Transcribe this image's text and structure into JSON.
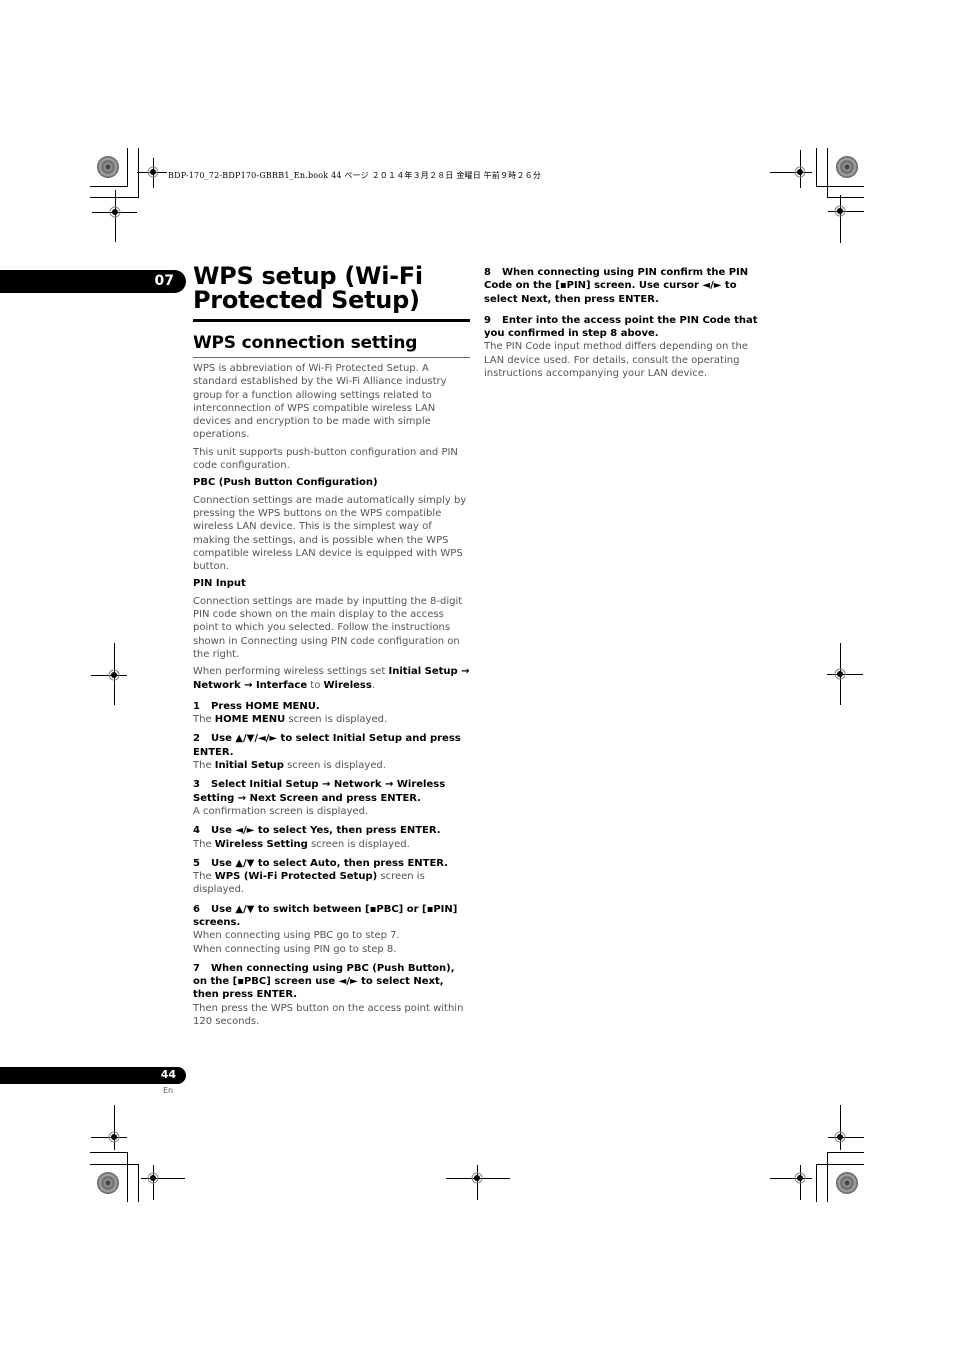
{
  "print_header": "BDP-170_72-BDP170-GBRB1_En.book  44 ページ  ２０１４年３月２８日  金曜日  午前９時２６分",
  "chapter": {
    "number": "07"
  },
  "title": "WPS setup (Wi-Fi Protected Setup)",
  "section": {
    "heading": "WPS connection setting",
    "intro": [
      "WPS is abbreviation of Wi-Fi Protected Setup. A standard established by the Wi-Fi Alliance industry group for a function allowing settings related to interconnection of WPS compatible wireless LAN devices and encryption to be made with simple operations.",
      "This unit supports push-button configuration and PIN code configuration."
    ],
    "pbc": {
      "heading": "PBC (Push Button Configuration)",
      "text": "Connection settings are made automatically simply by pressing the WPS buttons on the WPS compatible wireless LAN device. This is the simplest way of making the settings, and is possible when the WPS compatible wireless LAN device is equipped with WPS button."
    },
    "pin": {
      "heading": "PIN Input",
      "text": "Connection settings are made by inputting the 8-digit PIN code shown on the main display to the access point to which you selected. Follow the instructions shown in Connecting using PIN code configuration on the right."
    },
    "wireless_note": {
      "prefix": "When performing wireless settings set ",
      "b1": "Initial Setup",
      "arrow1": " → ",
      "b2": "Network",
      "arrow2": " → ",
      "b3": "Interface",
      "mid": " to ",
      "b4": "Wireless",
      "suffix": "."
    },
    "steps": [
      {
        "n": "1",
        "title": "Press HOME MENU.",
        "desc_pre": "The ",
        "desc_bold": "HOME MENU",
        "desc_post": " screen is displayed."
      },
      {
        "n": "2",
        "title": "Use ▲/▼/◄/► to select Initial Setup and press ENTER.",
        "desc_pre": "The ",
        "desc_bold": "Initial Setup",
        "desc_post": " screen is displayed."
      },
      {
        "n": "3",
        "title": "Select Initial Setup → Network → Wireless Setting → Next Screen and press ENTER.",
        "desc_pre": "A confirmation screen is displayed.",
        "desc_bold": "",
        "desc_post": ""
      },
      {
        "n": "4",
        "title": "Use ◄/► to select Yes, then press ENTER.",
        "desc_pre": "The ",
        "desc_bold": "Wireless Setting",
        "desc_post": " screen is displayed."
      },
      {
        "n": "5",
        "title": "Use ▲/▼ to select Auto, then press ENTER.",
        "desc_pre": "The ",
        "desc_bold": "WPS (Wi-Fi Protected Setup)",
        "desc_post": " screen is displayed."
      },
      {
        "n": "6",
        "title": "Use ▲/▼ to switch between [▪PBC] or [▪PIN] screens.",
        "desc_lines": [
          "When connecting using PBC go to step 7.",
          "When connecting using PIN go to step 8."
        ]
      },
      {
        "n": "7",
        "title": "When connecting using PBC (Push Button), on the [▪PBC] screen use ◄/► to select Next, then press ENTER.",
        "desc_pre": "Then press the WPS button on the access point within 120 seconds.",
        "desc_bold": "",
        "desc_post": ""
      },
      {
        "n": "8",
        "title": "When connecting using PIN confirm the PIN Code on the [▪PIN] screen. Use cursor ◄/► to select Next, then press ENTER."
      },
      {
        "n": "9",
        "title": "Enter into the access point the PIN Code that you confirmed in step 8 above.",
        "desc_pre": "The PIN Code input method differs depending on the LAN device used. For details, consult the operating instructions accompanying your LAN device.",
        "desc_bold": "",
        "desc_post": ""
      }
    ]
  },
  "footer": {
    "page_number": "44",
    "language": "En"
  }
}
